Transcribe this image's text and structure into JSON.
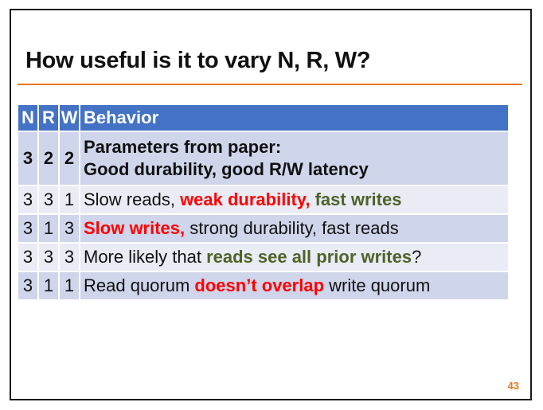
{
  "slide": {
    "title": "How useful is it to vary N, R, W?",
    "page_number": "43",
    "accent_color": "#e8771f",
    "header_color": "#4472c4"
  },
  "table": {
    "headers": {
      "n": "N",
      "r": "R",
      "w": "W",
      "behavior": "Behavior"
    },
    "rows": [
      {
        "n": "3",
        "r": "2",
        "w": "2",
        "line1": "Parameters from paper:",
        "line2": "Good durability, good R/W latency"
      },
      {
        "n": "3",
        "r": "3",
        "w": "1",
        "part1": "Slow reads, ",
        "part2": "weak durability,",
        "part3": " ",
        "part4": "fast writes"
      },
      {
        "n": "3",
        "r": "1",
        "w": "3",
        "part1": "Slow writes,",
        "part2": " strong durability, fast reads"
      },
      {
        "n": "3",
        "r": "3",
        "w": "3",
        "part1": "More likely that ",
        "part2": "reads see all prior writes",
        "part3": "?"
      },
      {
        "n": "3",
        "r": "1",
        "w": "1",
        "part1": "Read quorum ",
        "part2": "doesn’t overlap",
        "part3": " write quorum"
      }
    ]
  }
}
